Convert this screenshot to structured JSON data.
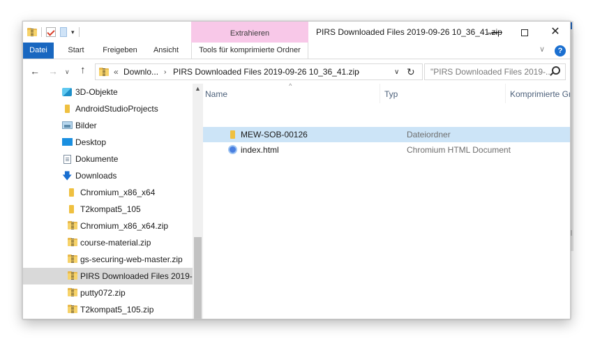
{
  "window": {
    "title_main": "PIRS Downloaded Files 2019-09-26 10_36_41.",
    "title_struck": "zip",
    "minimize_glyph": "—",
    "close_glyph": "✕",
    "qat_dropdown_glyph": "▾"
  },
  "ribbon": {
    "context_group": "Extrahieren",
    "tabs": {
      "file": "Datei",
      "start": "Start",
      "share": "Freigeben",
      "view": "Ansicht",
      "tools": "Tools für komprimierte Ordner"
    },
    "expand_glyph": "∨",
    "help_glyph": "?"
  },
  "nav": {
    "back_glyph": "←",
    "forward_glyph": "→",
    "recent_glyph": "∨",
    "up_glyph": "↑",
    "overflow": "«",
    "crumbs": [
      "Downlo...",
      "PIRS Downloaded Files 2019-09-26 10_36_41.zip"
    ],
    "crumb_sep": "›",
    "address_dd_glyph": "∨",
    "refresh_glyph": "↻",
    "search_placeholder": "\"PIRS Downloaded Files 2019-..."
  },
  "tree": {
    "scroll_up_glyph": "▲",
    "items": [
      {
        "label": "3D-Objekte",
        "icon": "3d-objects-icon"
      },
      {
        "label": "AndroidStudioProjects",
        "icon": "folder-icon"
      },
      {
        "label": "Bilder",
        "icon": "pictures-icon"
      },
      {
        "label": "Desktop",
        "icon": "desktop-icon"
      },
      {
        "label": "Dokumente",
        "icon": "documents-icon"
      },
      {
        "label": "Downloads",
        "icon": "download-icon"
      },
      {
        "label": "Chromium_x86_x64",
        "icon": "folder-icon"
      },
      {
        "label": "T2kompat5_105",
        "icon": "folder-icon"
      },
      {
        "label": "Chromium_x86_x64.zip",
        "icon": "zip-folder-icon"
      },
      {
        "label": "course-material.zip",
        "icon": "zip-folder-icon"
      },
      {
        "label": "gs-securing-web-master.zip",
        "icon": "zip-folder-icon"
      },
      {
        "label": "PIRS Downloaded Files 2019-0",
        "icon": "zip-folder-icon",
        "selected": true
      },
      {
        "label": "putty072.zip",
        "icon": "zip-folder-icon"
      },
      {
        "label": "T2kompat5_105.zip",
        "icon": "zip-folder-icon"
      }
    ]
  },
  "list": {
    "sort_glyph": "^",
    "columns": {
      "name": "Name",
      "type": "Typ",
      "compressed": "Komprimierte Gr"
    },
    "rows": [
      {
        "name": "MEW-SOB-00126",
        "type": "Dateiordner",
        "icon": "folder-icon",
        "selected": true
      },
      {
        "name": "index.html",
        "type": "Chromium HTML Document",
        "icon": "chromium-icon",
        "selected": false
      }
    ]
  },
  "colors": {
    "accent": "#1967c0",
    "context_tab": "#f8c8e8",
    "selection": "#cce4f7",
    "tree_selection": "#d9d9d9"
  }
}
